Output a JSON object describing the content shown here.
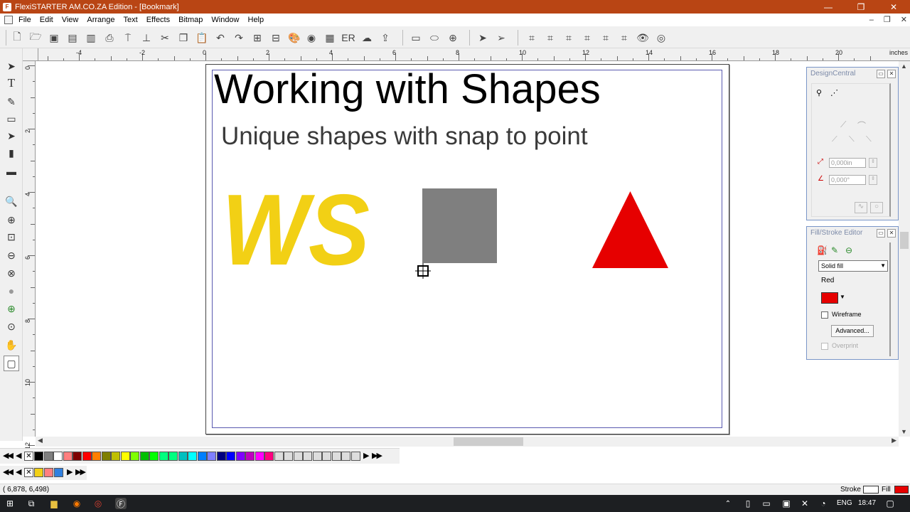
{
  "window": {
    "title": "FlexiSTARTER AM.CO.ZA Edition - [Bookmark]",
    "minimize": "—",
    "maximize": "❐",
    "close": "✕"
  },
  "menubar": {
    "items": [
      "File",
      "Edit",
      "View",
      "Arrange",
      "Text",
      "Effects",
      "Bitmap",
      "Window",
      "Help"
    ],
    "mdi_minimize": "–",
    "mdi_restore": "❐",
    "mdi_close": "✕"
  },
  "ruler": {
    "unit": "inches",
    "h_labels": [
      "-4",
      "-2",
      "0",
      "2",
      "4",
      "6",
      "8",
      "10",
      "12",
      "14",
      "16",
      "18",
      "20"
    ],
    "v_labels": [
      "0",
      "2",
      "4",
      "6",
      "8",
      "10",
      "12"
    ]
  },
  "canvas": {
    "heading": "Working with Shapes",
    "subheading": "Unique shapes with snap to point",
    "logo_text": "WS",
    "colors": {
      "logo": "#f2d015",
      "square": "#7f7f7f",
      "triangle": "#e60000",
      "page_border": "#5a5ab0"
    }
  },
  "design_central": {
    "title": "DesignCentral",
    "length_value": "0,000in",
    "angle_value": "0,000°"
  },
  "fill_stroke": {
    "title": "Fill/Stroke Editor",
    "fill_type": "Solid fill",
    "color_name": "Red",
    "color_hex": "#e60000",
    "wireframe_label": "Wireframe",
    "advanced_label": "Advanced...",
    "overprint_label": "Overprint"
  },
  "palette": {
    "swatches": [
      "#000000",
      "#7f7f7f",
      "#ffffff",
      "#ff7f7f",
      "#7f0000",
      "#ff0000",
      "#ff7f00",
      "#7f7f00",
      "#bfbf00",
      "#ffff00",
      "#7fff00",
      "#00bf00",
      "#00ff00",
      "#00ff7f",
      "#00ff80",
      "#00bfbf",
      "#00ffff",
      "#007fff",
      "#7f7fff",
      "#00007f",
      "#0000ff",
      "#7f00ff",
      "#bf00bf",
      "#ff00ff",
      "#ff0080"
    ],
    "recent": [
      "#f2d015",
      "#ff7f7f",
      "#3080e0"
    ]
  },
  "status": {
    "coords": "( 6,878,      6,498)",
    "stroke_label": "Stroke",
    "fill_label": "Fill",
    "fill_color": "#e60000"
  },
  "taskbar": {
    "language": "ENG",
    "time": "18:47"
  }
}
